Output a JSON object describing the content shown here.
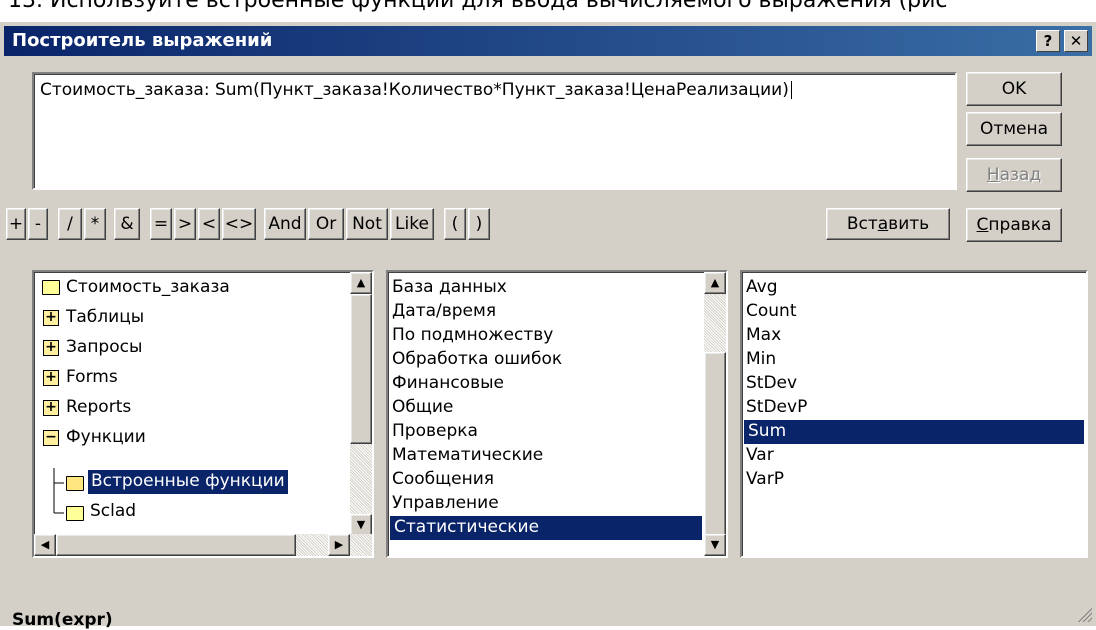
{
  "caption": "13. Используйте встроенные функции для ввода вычисляемого выражения (рис",
  "window": {
    "title": "Построитель выражений",
    "help_glyph": "?",
    "close_glyph": "✕"
  },
  "expression": {
    "value": "Стоимость_заказа: Sum(Пункт_заказа!Количество*Пункт_заказа!ЦенаРеализации)"
  },
  "buttons": {
    "ok": "OK",
    "cancel": "Отмена",
    "back_pre": "",
    "back_acc": "Н",
    "back_post": "азад",
    "help_pre": "",
    "help_acc": "С",
    "help_post": "правка",
    "insert_pre": "Вст",
    "insert_acc": "а",
    "insert_post": "вить"
  },
  "operators": [
    "+",
    "-",
    "/",
    "*",
    "&",
    "=",
    ">",
    "<",
    "<>",
    "And",
    "Or",
    "Not",
    "Like",
    "(",
    ")"
  ],
  "tree": {
    "items": [
      {
        "label": "Стоимость_заказа",
        "icon": "folder-icon"
      },
      {
        "label": "Таблицы",
        "icon": "expand-plus-icon"
      },
      {
        "label": "Запросы",
        "icon": "expand-plus-icon"
      },
      {
        "label": "Forms",
        "icon": "expand-plus-icon"
      },
      {
        "label": "Reports",
        "icon": "expand-plus-icon"
      },
      {
        "label": "Функции",
        "icon": "collapse-minus-icon"
      },
      {
        "label": "Встроенные функции",
        "icon": "open-folder-icon",
        "selected": true
      },
      {
        "label": "Sclad",
        "icon": "folder-icon"
      }
    ]
  },
  "categories": {
    "items": [
      "База данных",
      "Дата/время",
      "По подмножеству",
      "Обработка ошибок",
      "Финансовые",
      "Общие",
      "Проверка",
      "Математические",
      "Сообщения",
      "Управление",
      "Статистические"
    ],
    "selected_index": 10
  },
  "functions": {
    "items": [
      "Avg",
      "Count",
      "Max",
      "Min",
      "StDev",
      "StDevP",
      "Sum",
      "Var",
      "VarP"
    ],
    "selected_index": 6
  },
  "status": {
    "signature": "Sum(expr)"
  },
  "colors": {
    "selection": "#0a246a",
    "face": "#d4d0c8",
    "titlebar": "#0a246a"
  }
}
